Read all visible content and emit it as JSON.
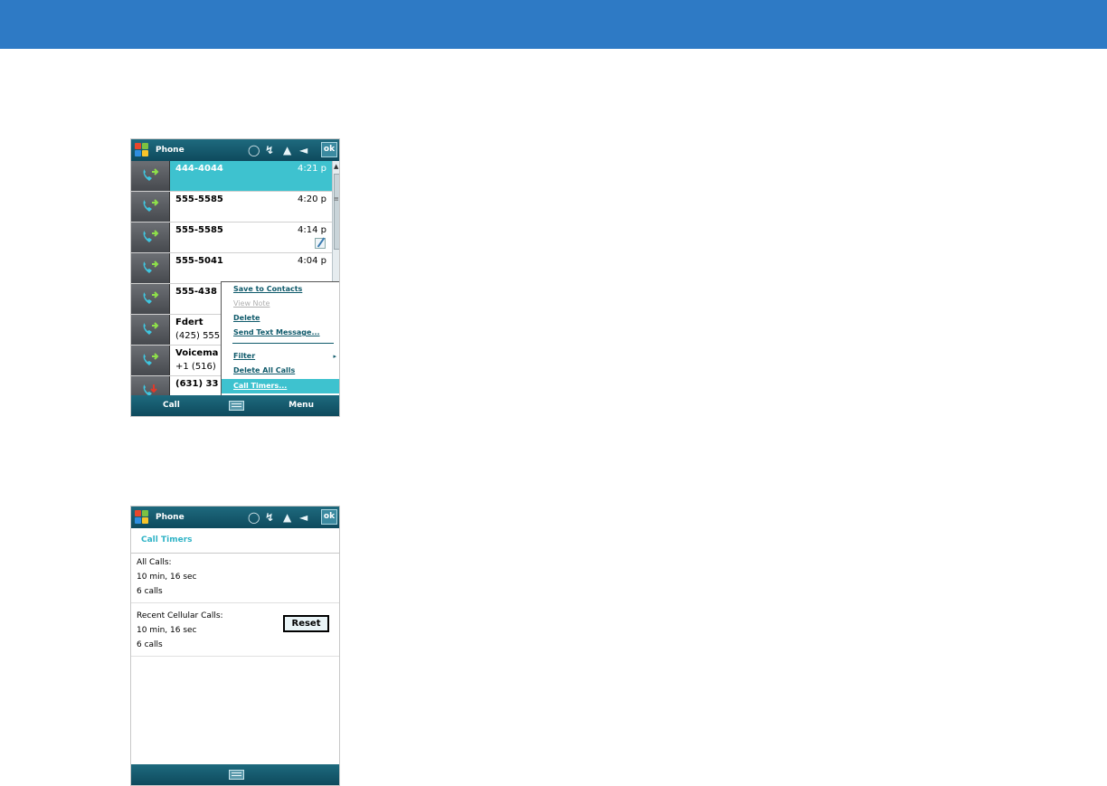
{
  "colors": {
    "banner": "#2e7ac5",
    "titlebar": "#0e4a5d",
    "highlight": "#3ec2cf",
    "menu_text": "#0f5a6b",
    "screen_title": "#2fb3c6"
  },
  "screen1": {
    "title": "Phone",
    "ok": "ok",
    "status_icons": [
      "message-icon",
      "connectivity-icon",
      "signal-icon",
      "speaker-icon"
    ],
    "calls": [
      {
        "number": "444-4044",
        "time": "4:21 p",
        "icon": "outgoing-call-icon",
        "selected": true
      },
      {
        "number": "555-5585",
        "time": "4:20 p",
        "icon": "outgoing-call-icon"
      },
      {
        "number": "555-5585",
        "time": "4:14 p",
        "icon": "outgoing-call-icon",
        "note": "note-icon"
      },
      {
        "number": "555-5041",
        "time": "4:04 p",
        "icon": "outgoing-call-icon"
      },
      {
        "number": "555-438",
        "time": "",
        "icon": "outgoing-call-icon"
      },
      {
        "number": "Fdert",
        "sub": "(425) 555",
        "time": "",
        "icon": "outgoing-call-icon"
      },
      {
        "number": "Voicema",
        "sub": "+1 (516)",
        "time": "",
        "icon": "outgoing-call-icon"
      },
      {
        "number": "(631) 33",
        "time": "",
        "icon": "missed-call-icon"
      }
    ],
    "menu": {
      "items": [
        {
          "label": "Save to Contacts"
        },
        {
          "label": "View Note",
          "disabled": true
        },
        {
          "label": "Delete"
        },
        {
          "label": "Send Text Message..."
        },
        {
          "label": "Filter",
          "submenu": "▸"
        },
        {
          "label": "Delete All Calls"
        },
        {
          "label": "Call Timers...",
          "active": true
        }
      ]
    },
    "softkeys": {
      "left": "Call",
      "right": "Menu"
    }
  },
  "screen2": {
    "title": "Phone",
    "ok": "ok",
    "header": "Call Timers",
    "all_calls": {
      "label": "All Calls:",
      "duration": "10 min, 16 sec",
      "count": "6 calls"
    },
    "recent_calls": {
      "label": "Recent Cellular Calls:",
      "duration": "10 min, 16 sec",
      "count": "6 calls",
      "reset": "Reset"
    }
  }
}
